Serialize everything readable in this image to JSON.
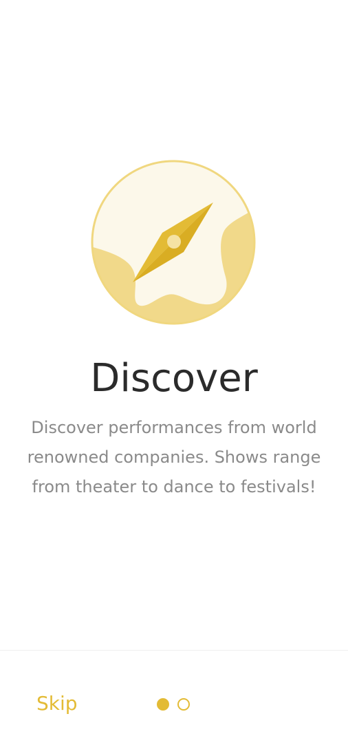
{
  "onboarding": {
    "title": "Discover",
    "description": "Discover performances from world renowned companies. Shows range from theater to dance to festivals!",
    "illustration_icon": "compass-icon",
    "current_page": 1,
    "total_pages": 2
  },
  "footer": {
    "skip_label": "Skip"
  },
  "colors": {
    "accent": "#e3bb35",
    "illustration_light": "#fcf8ea",
    "illustration_mid": "#f1d98a",
    "illustration_border": "#f0d77f",
    "title": "#2b2b2b",
    "body": "#8a8a8a"
  }
}
